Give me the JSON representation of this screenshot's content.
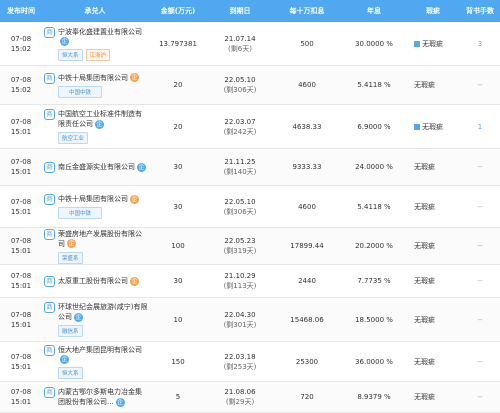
{
  "headers": [
    "发布时间",
    "承兑人",
    "金额(万元)",
    "到期日",
    "每十万扣息",
    "年息",
    "瑕疵",
    "背书手数"
  ],
  "rows": [
    {
      "date": "07-08",
      "time": "15:02",
      "company": "宁波奉化盛建置业有限公司",
      "icon": "blue",
      "tags": [
        {
          "text": "恒大系",
          "type": "blue"
        },
        {
          "text": "江浙沪",
          "type": "orange"
        }
      ],
      "amount": "13.797381",
      "due": "21.07.14",
      "remain": "(剩6天)",
      "deduct": "500",
      "rate": "30.0000 %",
      "flaw": "无瑕疵",
      "bond": true,
      "endorse": "3",
      "endorse_link": true
    },
    {
      "date": "07-08",
      "time": "15:02",
      "company": "中铁十局集团有限公司",
      "icon": "orange",
      "tags": [
        {
          "text": "中国中铁",
          "type": "blue-wide"
        }
      ],
      "amount": "20",
      "due": "22.05.10",
      "remain": "(剩306天)",
      "deduct": "4600",
      "rate": "5.4118 %",
      "flaw": "无瑕疵",
      "bond": false,
      "endorse": "--",
      "endorse_link": false
    },
    {
      "date": "07-08",
      "time": "15:01",
      "company": "中国航空工业标准件制造有限责任公司",
      "icon": "blue",
      "tags": [
        {
          "text": "航空工业",
          "type": "blue"
        }
      ],
      "amount": "20",
      "due": "22.03.07",
      "remain": "(剩242天)",
      "deduct": "4638.33",
      "rate": "6.9000 %",
      "flaw": "无瑕疵",
      "bond": true,
      "endorse": "1",
      "endorse_link": true
    },
    {
      "date": "07-08",
      "time": "15:01",
      "company": "南丘金盛源实业有限公司",
      "icon": "blue",
      "tags": [],
      "amount": "30",
      "due": "21.11.25",
      "remain": "(剩140天)",
      "deduct": "9333.33",
      "rate": "24.0000 %",
      "flaw": "无瑕疵",
      "bond": false,
      "endorse": "--",
      "endorse_link": false
    },
    {
      "date": "07-08",
      "time": "15:01",
      "company": "中铁十局集团有限公司",
      "icon": "orange",
      "tags": [
        {
          "text": "中国中铁",
          "type": "blue-wide"
        }
      ],
      "amount": "30",
      "due": "22.05.10",
      "remain": "(剩306天)",
      "deduct": "4600",
      "rate": "5.4118 %",
      "flaw": "无瑕疵",
      "bond": false,
      "endorse": "--",
      "endorse_link": false
    },
    {
      "date": "07-08",
      "time": "15:01",
      "company": "荣盛房地产发展股份有限公司",
      "icon": "orange",
      "tags": [
        {
          "text": "荣盛系",
          "type": "blue"
        }
      ],
      "amount": "100",
      "due": "22.05.23",
      "remain": "(剩319天)",
      "deduct": "17899.44",
      "rate": "20.2000 %",
      "flaw": "无瑕疵",
      "bond": false,
      "endorse": "--",
      "endorse_link": false
    },
    {
      "date": "07-08",
      "time": "15:01",
      "company": "太原重工股份有限公司",
      "icon": "orange",
      "tags": [],
      "amount": "30",
      "due": "21.10.29",
      "remain": "(剩113天)",
      "deduct": "2440",
      "rate": "7.7735 %",
      "flaw": "无瑕疵",
      "bond": false,
      "endorse": "--",
      "endorse_link": false
    },
    {
      "date": "07-08",
      "time": "15:01",
      "company": "环球世纪会展旅游(咸宁)有限公司",
      "icon": "blue",
      "tags": [
        {
          "text": "融信系",
          "type": "blue"
        }
      ],
      "amount": "10",
      "due": "22.04.30",
      "remain": "(剩301天)",
      "deduct": "15468.06",
      "rate": "18.5000 %",
      "flaw": "无瑕疵",
      "bond": false,
      "endorse": "--",
      "endorse_link": false
    },
    {
      "date": "07-08",
      "time": "15:01",
      "company": "恒大地产集团昆明有限公司",
      "icon": "blue",
      "tags": [
        {
          "text": "恒大系",
          "type": "blue"
        }
      ],
      "amount": "150",
      "due": "22.03.18",
      "remain": "(剩253天)",
      "deduct": "25300",
      "rate": "36.0000 %",
      "flaw": "无瑕疵",
      "bond": false,
      "endorse": "--",
      "endorse_link": false
    },
    {
      "date": "07-08",
      "time": "15:01",
      "company": "内蒙古鄂尔多斯电力冶金集团股份有限公司...",
      "icon": "blue",
      "tags": [],
      "amount": "5",
      "due": "21.08.06",
      "remain": "(剩29天)",
      "deduct": "720",
      "rate": "8.9379 %",
      "flaw": "无瑕疵",
      "bond": false,
      "endorse": "--",
      "endorse_link": false
    }
  ]
}
